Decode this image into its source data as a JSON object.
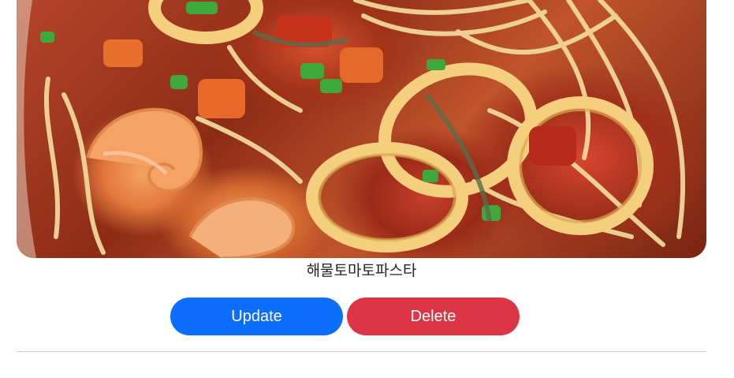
{
  "post": {
    "image_alt": "seafood tomato pasta photo",
    "dish_name": "해물토마토파스타"
  },
  "actions": {
    "update_label": "Update",
    "delete_label": "Delete"
  },
  "colors": {
    "update_button": "#0d6efd",
    "delete_button": "#dc3545",
    "divider": "#cccccc"
  }
}
